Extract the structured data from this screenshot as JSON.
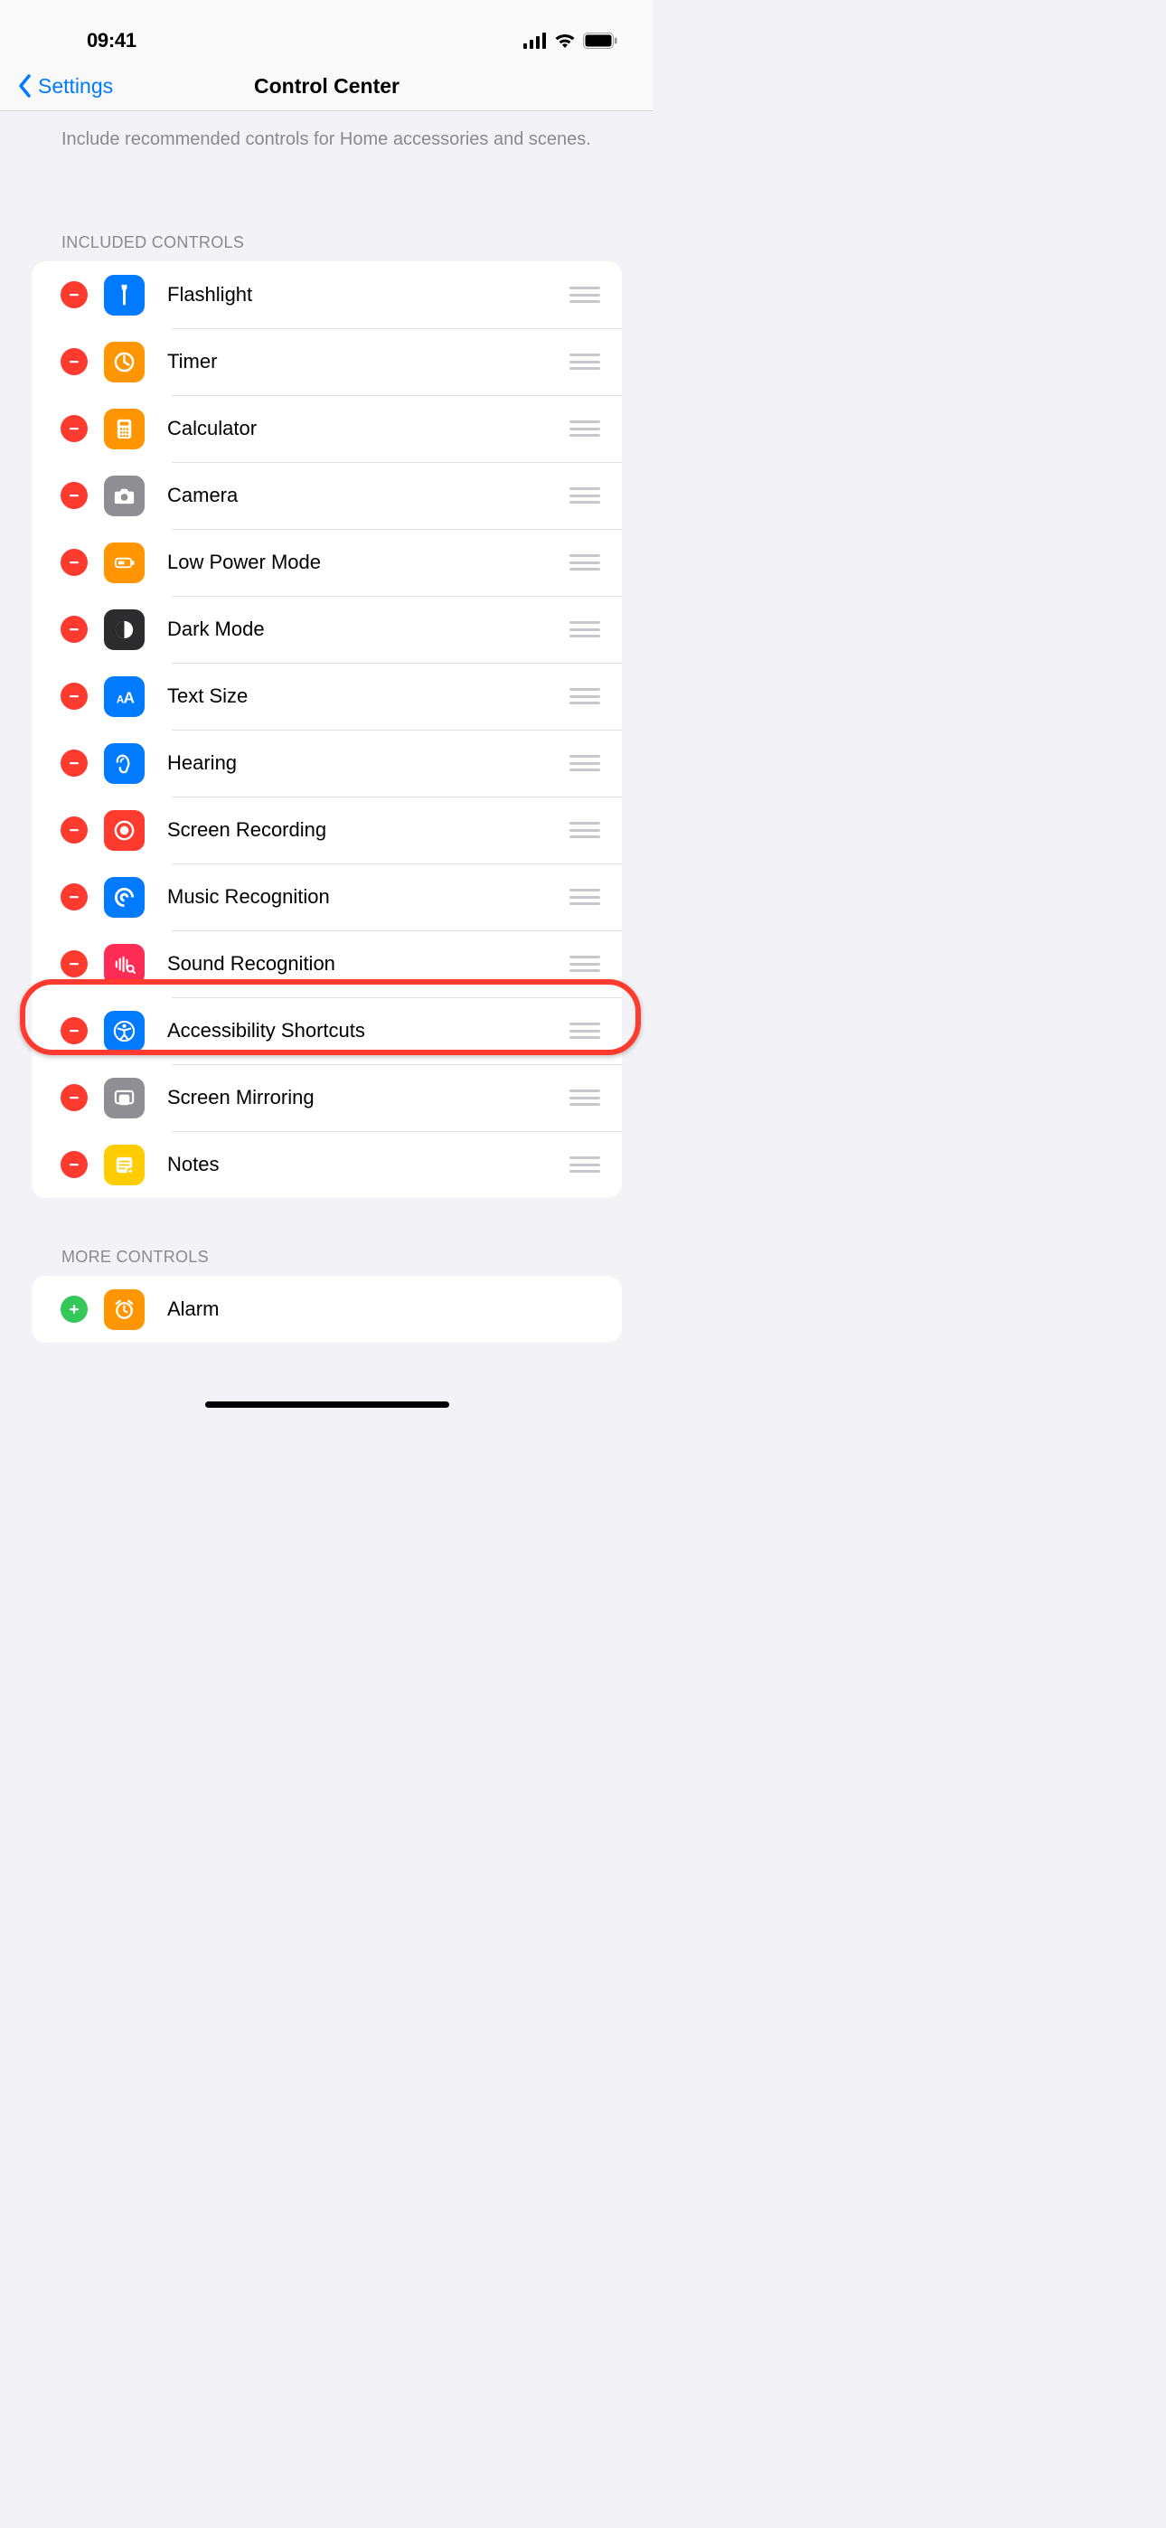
{
  "status": {
    "time": "09:41"
  },
  "nav": {
    "back": "Settings",
    "title": "Control Center"
  },
  "helper": "Include recommended controls for Home accessories and scenes.",
  "section_included": "INCLUDED CONTROLS",
  "section_more": "MORE CONTROLS",
  "highlight_index": 10,
  "included": [
    {
      "label": "Flashlight",
      "icon": "flashlight-icon",
      "bg": "bg-blue"
    },
    {
      "label": "Timer",
      "icon": "timer-icon",
      "bg": "bg-orange"
    },
    {
      "label": "Calculator",
      "icon": "calculator-icon",
      "bg": "bg-orange"
    },
    {
      "label": "Camera",
      "icon": "camera-icon",
      "bg": "bg-gray"
    },
    {
      "label": "Low Power Mode",
      "icon": "low-power-icon",
      "bg": "bg-orange"
    },
    {
      "label": "Dark Mode",
      "icon": "dark-mode-icon",
      "bg": "bg-dark"
    },
    {
      "label": "Text Size",
      "icon": "text-size-icon",
      "bg": "bg-blue"
    },
    {
      "label": "Hearing",
      "icon": "hearing-icon",
      "bg": "bg-blue"
    },
    {
      "label": "Screen Recording",
      "icon": "screen-record-icon",
      "bg": "bg-red"
    },
    {
      "label": "Music Recognition",
      "icon": "music-rec-icon",
      "bg": "bg-blue"
    },
    {
      "label": "Sound Recognition",
      "icon": "sound-rec-icon",
      "bg": "bg-pink"
    },
    {
      "label": "Accessibility Shortcuts",
      "icon": "accessibility-icon",
      "bg": "bg-blue"
    },
    {
      "label": "Screen Mirroring",
      "icon": "mirroring-icon",
      "bg": "bg-gray"
    },
    {
      "label": "Notes",
      "icon": "notes-icon",
      "bg": "bg-yellow"
    }
  ],
  "more": [
    {
      "label": "Alarm",
      "icon": "alarm-icon",
      "bg": "bg-orange"
    }
  ]
}
